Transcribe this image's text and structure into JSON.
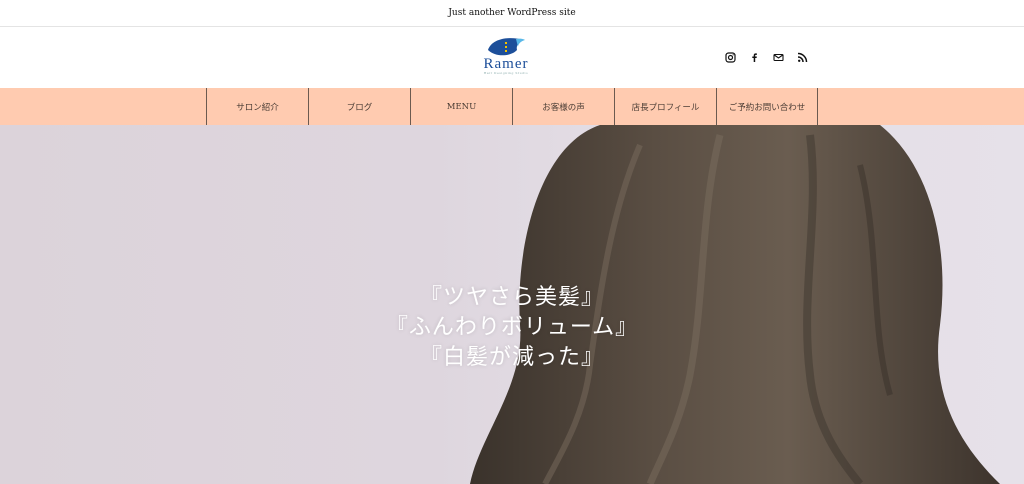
{
  "site": {
    "tagline": "Just another WordPress site",
    "logo_text": "Ramer",
    "logo_subtext": "Hair Designing Studio"
  },
  "social": [
    {
      "name": "instagram-icon"
    },
    {
      "name": "facebook-icon"
    },
    {
      "name": "mail-icon"
    },
    {
      "name": "rss-icon"
    }
  ],
  "nav": {
    "items": [
      {
        "label": "サロン紹介"
      },
      {
        "label": "ブログ"
      },
      {
        "label": "MENU"
      },
      {
        "label": "お客様の声"
      },
      {
        "label": "店長プロフィール"
      },
      {
        "label": "ご予約お問い合わせ"
      }
    ]
  },
  "hero": {
    "lines": [
      "『ツヤさら美髪』",
      "『ふんわりボリューム』",
      "『白髪が減った』"
    ]
  },
  "colors": {
    "nav_bg": "#ffcbb0",
    "nav_border": "#6b5a50",
    "logo_blue": "#1d4f9a",
    "hair": "#4e4338"
  }
}
